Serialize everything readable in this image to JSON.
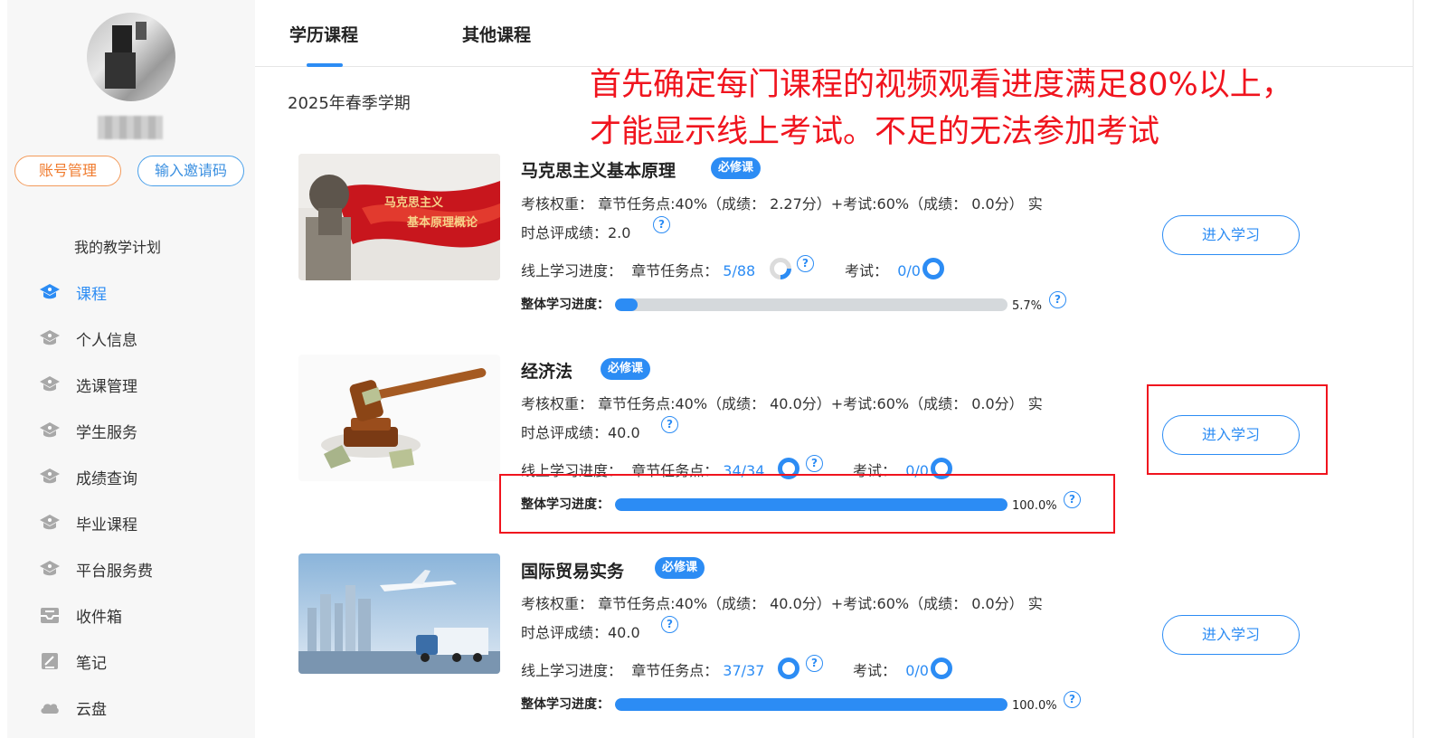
{
  "sidebar": {
    "account_button": "账号管理",
    "invite_button": "输入邀请码",
    "plan_title": "我的教学计划",
    "items": [
      {
        "label": "课程",
        "icon": "graduation-cap-icon",
        "active": true
      },
      {
        "label": "个人信息",
        "icon": "graduation-cap-icon"
      },
      {
        "label": "选课管理",
        "icon": "graduation-cap-icon"
      },
      {
        "label": "学生服务",
        "icon": "graduation-cap-icon"
      },
      {
        "label": "成绩查询",
        "icon": "graduation-cap-icon"
      },
      {
        "label": "毕业课程",
        "icon": "graduation-cap-icon"
      },
      {
        "label": "平台服务费",
        "icon": "graduation-cap-icon"
      },
      {
        "label": "收件箱",
        "icon": "inbox-icon"
      },
      {
        "label": "笔记",
        "icon": "note-icon"
      },
      {
        "label": "云盘",
        "icon": "cloud-icon"
      }
    ]
  },
  "tabs": [
    "学历课程",
    "其他课程"
  ],
  "semester": "2025年春季学期",
  "annotation": {
    "line1": "首先确定每门课程的视频观看进度满足80%以上，",
    "line2": "才能显示线上考试。不足的无法参加考试"
  },
  "courses": [
    {
      "name": "马克思主义基本原理",
      "badge": "必修课",
      "weight_line": "考核权重：  章节任务点:40%（成绩：  2.27分）+考试:60%（成绩：  0.0分）  实",
      "total_line": "时总评成绩：2.0",
      "online_label": "线上学习进度：",
      "chapter_label": "章节任务点：",
      "chapter_value": "5/88",
      "exam_label": "考试：",
      "exam_value": "0/0",
      "overall_label": "整体学习进度：",
      "overall_pct_text": "5.7%",
      "overall_fraction": 0.057,
      "button": "进入学习"
    },
    {
      "name": "经济法",
      "badge": "必修课",
      "weight_line": "考核权重：  章节任务点:40%（成绩：  40.0分）+考试:60%（成绩：  0.0分）  实",
      "total_line": "时总评成绩：40.0",
      "online_label": "线上学习进度：",
      "chapter_label": "章节任务点：",
      "chapter_value": "34/34",
      "exam_label": "考试：",
      "exam_value": "0/0",
      "overall_label": "整体学习进度：",
      "overall_pct_text": "100.0%",
      "overall_fraction": 1.0,
      "button": "进入学习"
    },
    {
      "name": "国际贸易实务",
      "badge": "必修课",
      "weight_line": "考核权重：  章节任务点:40%（成绩：  40.0分）+考试:60%（成绩：  0.0分）  实",
      "total_line": "时总评成绩：40.0",
      "online_label": "线上学习进度：",
      "chapter_label": "章节任务点：",
      "chapter_value": "37/37",
      "exam_label": "考试：",
      "exam_value": "0/0",
      "overall_label": "整体学习进度：",
      "overall_pct_text": "100.0%",
      "overall_fraction": 1.0,
      "button": "进入学习"
    }
  ],
  "thumb_text": {
    "line1": "马克思主义",
    "line2": "基本原理概论"
  },
  "colors": {
    "accent": "#2c8cf4",
    "annotation_red": "#f0141e",
    "orange": "#f07b2e"
  }
}
